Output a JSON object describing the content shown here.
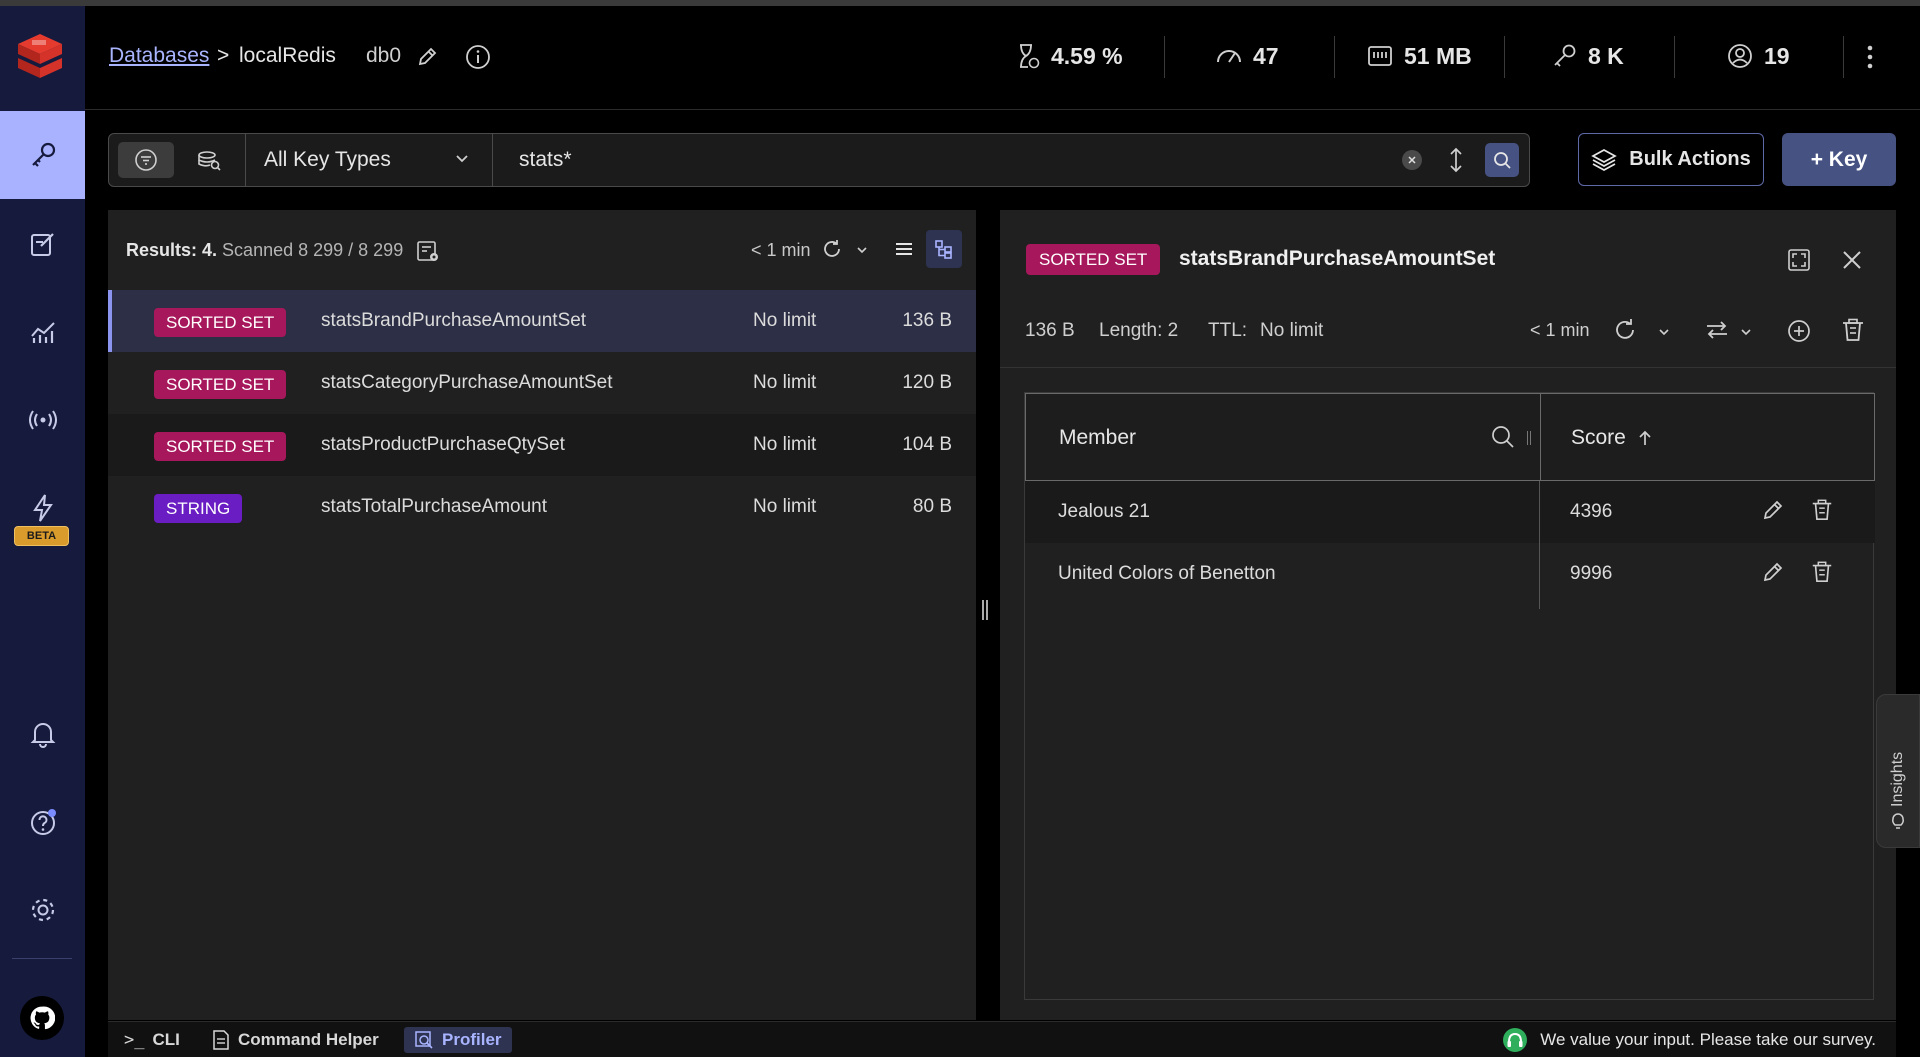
{
  "header": {
    "breadcrumb_link": "Databases",
    "breadcrumb_sep": ">",
    "database_name": "localRedis",
    "db_index": "db0",
    "stats": {
      "cpu": "4.59 %",
      "ops": "47",
      "memory": "51 MB",
      "keys": "8 K",
      "clients": "19"
    }
  },
  "sidebar": {
    "beta_label": "BETA",
    "items": [
      "browser",
      "workbench",
      "analysis",
      "pubsub",
      "triggers"
    ]
  },
  "toolbar": {
    "key_type_value": "All Key Types",
    "search_value": "stats*",
    "bulk_actions_label": "Bulk Actions",
    "add_key_label": "+ Key"
  },
  "list": {
    "results_label": "Results: 4.",
    "scanned_label": "Scanned 8 299 / 8 299",
    "refresh_label": "< 1 min",
    "rows": [
      {
        "type": "SORTED SET",
        "name": "statsBrandPurchaseAmountSet",
        "ttl": "No limit",
        "size": "136 B"
      },
      {
        "type": "SORTED SET",
        "name": "statsCategoryPurchaseAmountSet",
        "ttl": "No limit",
        "size": "120 B"
      },
      {
        "type": "SORTED SET",
        "name": "statsProductPurchaseQtySet",
        "ttl": "No limit",
        "size": "104 B"
      },
      {
        "type": "STRING",
        "name": "statsTotalPurchaseAmount",
        "ttl": "No limit",
        "size": "80 B"
      }
    ]
  },
  "detail": {
    "type": "SORTED SET",
    "key_name": "statsBrandPurchaseAmountSet",
    "size": "136 B",
    "length": "Length: 2",
    "ttl_label": "TTL:",
    "ttl_value": "No limit",
    "refresh_label": "< 1 min",
    "columns": {
      "member": "Member",
      "score": "Score"
    },
    "rows": [
      {
        "member": "Jealous 21",
        "score": "4396"
      },
      {
        "member": "United Colors of Benetton",
        "score": "9996"
      }
    ]
  },
  "insights_label": "Insights",
  "bottom": {
    "cli": "CLI",
    "cli_prompt": ">_",
    "helper": "Command Helper",
    "profiler": "Profiler",
    "survey": "We value your input. Please take our survey."
  },
  "colors": {
    "sidebar_bg": "#161a3d",
    "accent": "#465282",
    "sorted_set_badge": "#a6185b",
    "string_badge": "#6a1dc3",
    "link": "#a9b4ff"
  }
}
